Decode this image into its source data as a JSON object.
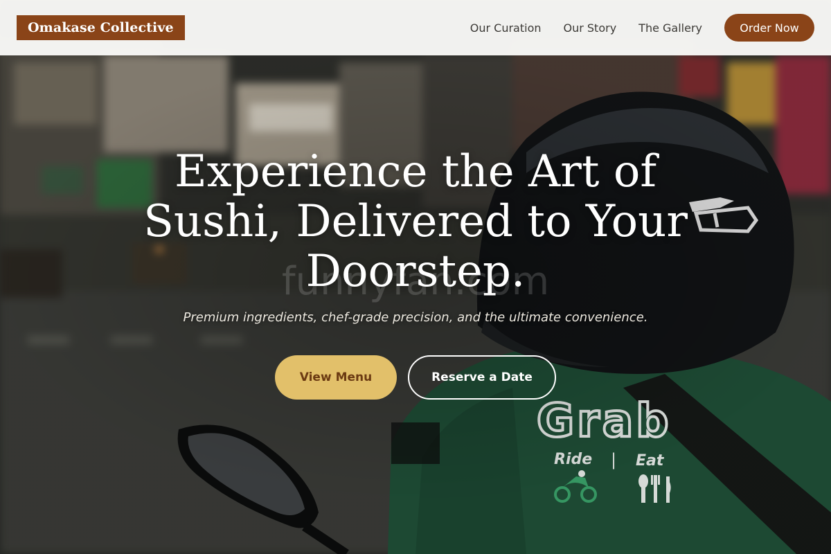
{
  "header": {
    "brand": "Omakase Collective",
    "nav": [
      "Our Curation",
      "Our Story",
      "The Gallery"
    ],
    "order_button": "Order Now"
  },
  "hero": {
    "headline": "Experience the Art of Sushi, Delivered to Your Doorstep.",
    "subheadline": "Premium ingredients, chef-grade precision, and the ultimate convenience.",
    "primary_button": "View Menu",
    "secondary_button": "Reserve a Date",
    "watermark": "funnyfan.com",
    "jacket_text": {
      "logo": "Grab",
      "ride": "Ride",
      "eat": "Eat"
    }
  },
  "colors": {
    "brand": "#8a4418",
    "primary_button": "#e2c06a",
    "header_bg": "#fafaf8",
    "jacket": "#1f5a3c"
  },
  "icons": [
    "helmet-visor-logo",
    "scooter-icon",
    "utensils-icon"
  ]
}
